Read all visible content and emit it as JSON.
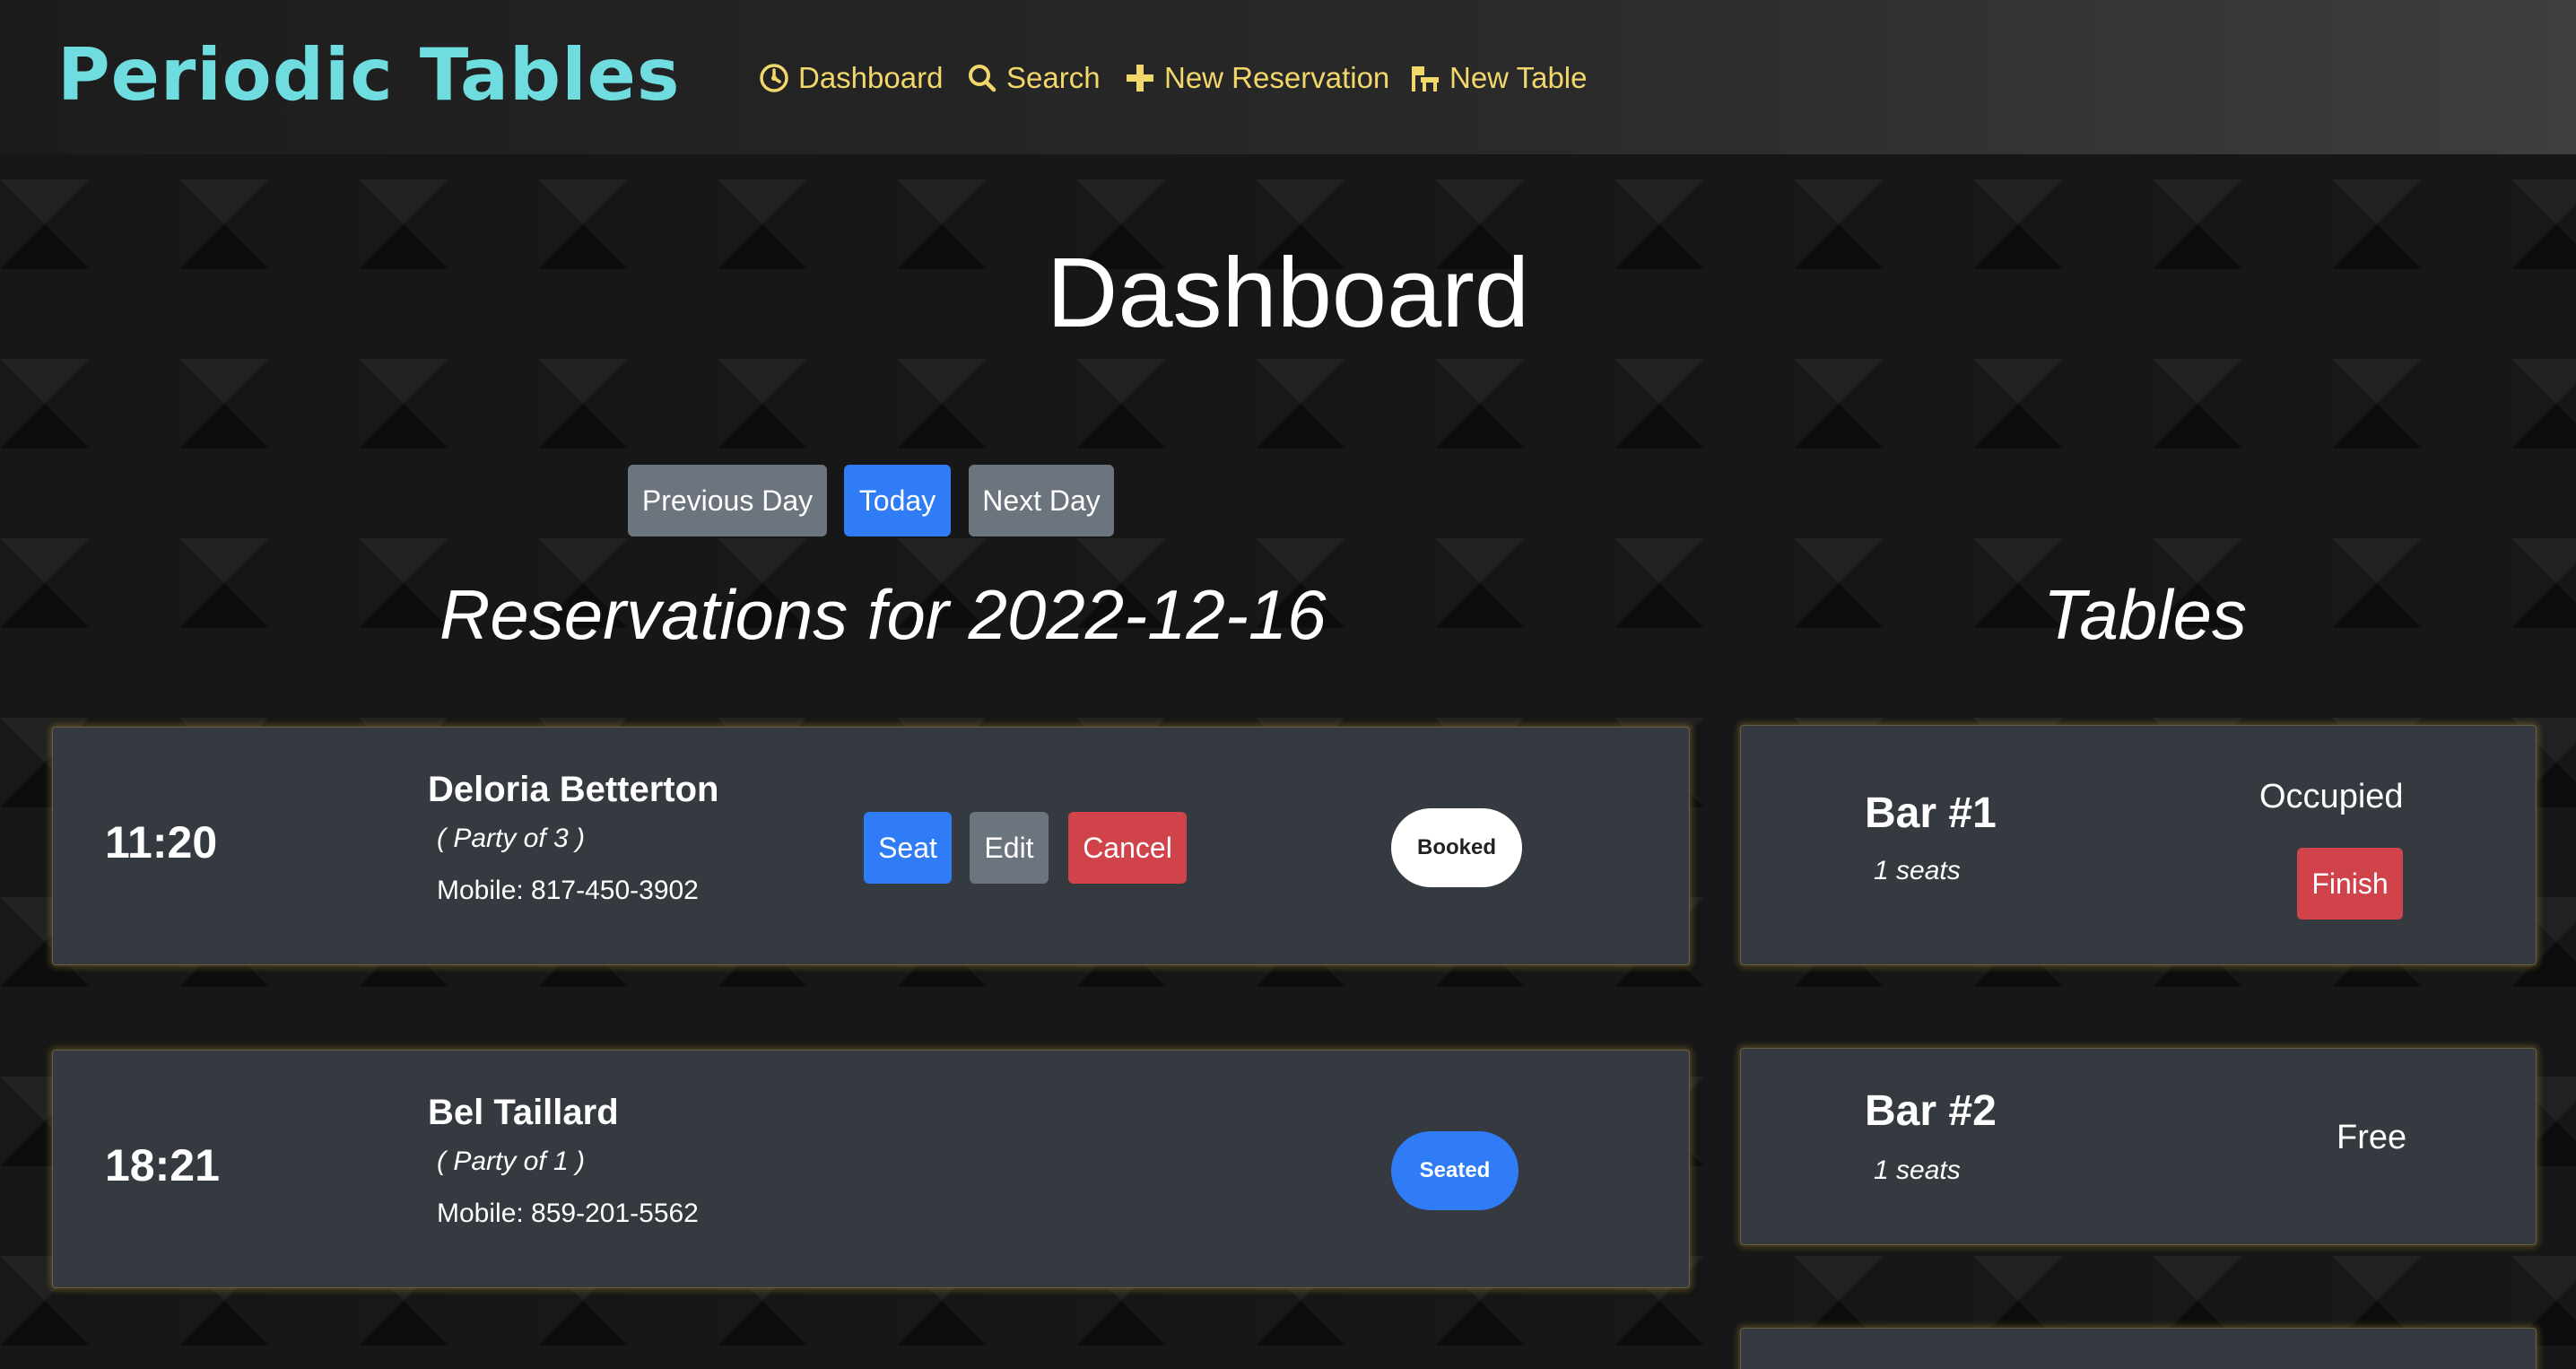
{
  "brand": "Periodic Tables",
  "nav": {
    "dashboard": "Dashboard",
    "search": "Search",
    "new_reservation": "New Reservation",
    "new_table": "New Table"
  },
  "page_title": "Dashboard",
  "date_nav": {
    "previous": "Previous Day",
    "today": "Today",
    "next": "Next Day"
  },
  "reservations_heading": "Reservations for 2022-12-16",
  "tables_heading": "Tables",
  "reservations": [
    {
      "time": "11:20",
      "name": "Deloria Betterton",
      "party": "( Party of 3 )",
      "mobile": "Mobile: 817-450-3902",
      "actions": {
        "seat": "Seat",
        "edit": "Edit",
        "cancel": "Cancel"
      },
      "status": "Booked"
    },
    {
      "time": "18:21",
      "name": "Bel Taillard",
      "party": "( Party of 1 )",
      "mobile": "Mobile: 859-201-5562",
      "status": "Seated"
    }
  ],
  "tables": [
    {
      "name": "Bar #1",
      "seats": "1 seats",
      "status": "Occupied",
      "finish": "Finish"
    },
    {
      "name": "Bar #2",
      "seats": "1 seats",
      "status": "Free"
    }
  ],
  "colors": {
    "brand": "#6fdcdf",
    "nav_link": "#f2d76a",
    "primary": "#2f7cf6",
    "secondary": "#6c757d",
    "danger": "#d1434b",
    "card": "#353a40"
  }
}
